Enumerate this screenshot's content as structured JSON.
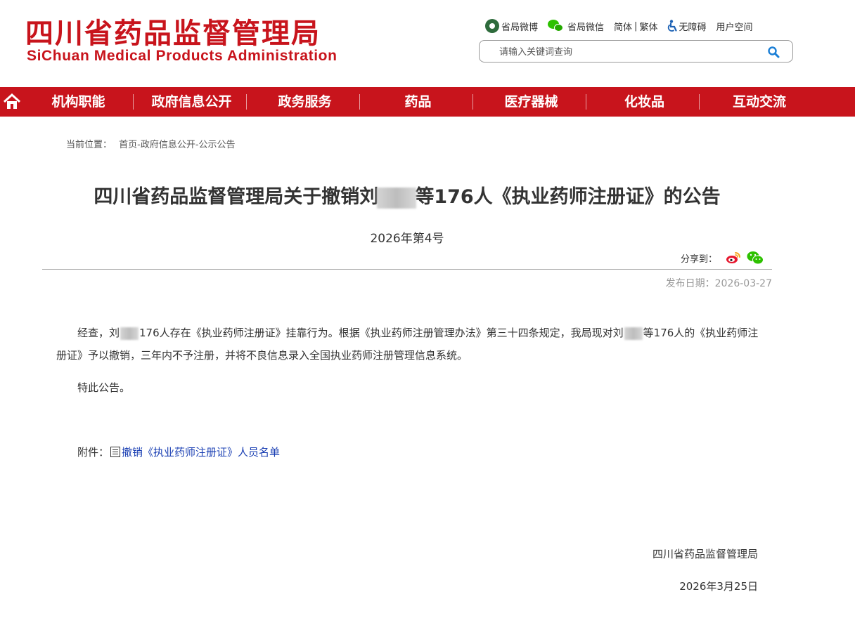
{
  "header": {
    "logo_cn": "四川省药品监督管理局",
    "logo_en": "SiChuan Medical Products Administration",
    "links": {
      "weibo": "省局微博",
      "wechat": "省局微信",
      "simplified": "简体",
      "separator": "|",
      "traditional": "繁体",
      "accessibility": "无障碍",
      "user_space": "用户空间"
    },
    "search": {
      "placeholder": "请输入关键词查询",
      "value": ""
    }
  },
  "nav": {
    "items": [
      {
        "label": "机构职能"
      },
      {
        "label": "政府信息公开"
      },
      {
        "label": "政务服务"
      },
      {
        "label": "药品"
      },
      {
        "label": "医疗器械"
      },
      {
        "label": "化妆品"
      },
      {
        "label": "互动交流"
      }
    ],
    "colors": {
      "background": "#c8141c",
      "text": "#ffffff"
    }
  },
  "breadcrumb": {
    "label": "当前位置：",
    "path": "首页-政府信息公开-公示公告"
  },
  "article": {
    "title_part1": "四川省药品监督管理局关于撤销刘",
    "title_part2": "等176人《执业药师注册证》的公告",
    "subtitle": "2026年第4号",
    "share_label": "分享到：",
    "publish_date": "发布日期：2026-03-27",
    "para1_part1": "经查，刘",
    "para1_part2": "176人存在《执业药师注册证》挂靠行为。根据《执业药师注册管理办法》第三十四条规定，我局现对刘",
    "para1_part3": "等176人的《执业药师注册证》予以撤销，三年内不予注册，并将不良信息录入全国执业药师注册管理信息系统。",
    "para2": "特此公告。",
    "attachment_label": "附件：",
    "attachment_link": "撤销《执业药师注册证》人员名单",
    "sign_org": "四川省药品监督管理局",
    "sign_date": "2026年3月25日"
  },
  "icons": {
    "home": "home-icon",
    "search": "search-icon",
    "weibo": "weibo-icon",
    "wechat": "wechat-icon",
    "accessibility": "accessibility-icon",
    "document": "document-icon"
  },
  "colors": {
    "brand_red": "#c8141c",
    "link_blue": "#1a3fb3",
    "muted_gray": "#999999"
  }
}
